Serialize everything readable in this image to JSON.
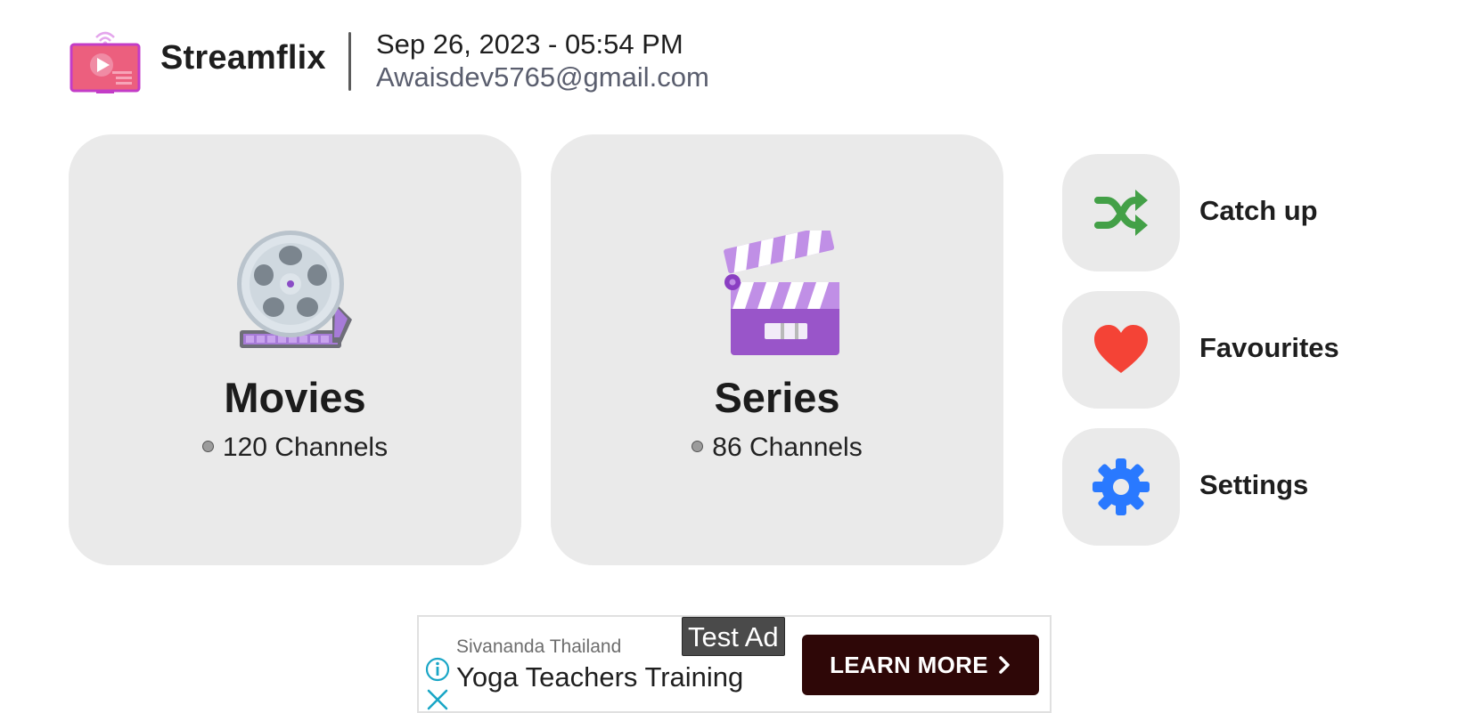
{
  "header": {
    "app_name": "Streamflix",
    "datetime": "Sep 26, 2023 - 05:54 PM",
    "email": "Awaisdev5765@gmail.com"
  },
  "cards": [
    {
      "title": "Movies",
      "count": "120 Channels",
      "icon": "film-reel-icon"
    },
    {
      "title": "Series",
      "count": "86 Channels",
      "icon": "clapperboard-icon"
    }
  ],
  "side_menu": [
    {
      "label": "Catch up",
      "icon": "shuffle-icon",
      "color": "#43a047"
    },
    {
      "label": "Favourites",
      "icon": "heart-icon",
      "color": "#f44336"
    },
    {
      "label": "Settings",
      "icon": "gear-icon",
      "color": "#2979ff"
    }
  ],
  "ad": {
    "badge": "Test Ad",
    "advertiser": "Sivananda Thailand",
    "headline": "Yoga Teachers Training",
    "cta": "LEARN MORE",
    "info_icon": "info-icon",
    "close_icon": "close-icon"
  },
  "colors": {
    "background": "#ffffff",
    "tile": "#eaeaea",
    "logo_pink": "#ec5f7e",
    "logo_purple": "#c33cc7",
    "cta_bg": "#2e0707"
  }
}
